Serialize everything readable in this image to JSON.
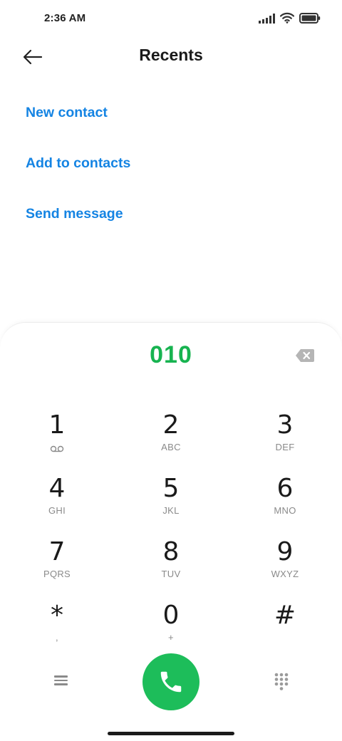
{
  "status_bar": {
    "time": "2:36 AM",
    "icons": [
      "signal-icon",
      "wifi-icon",
      "battery-icon"
    ]
  },
  "header": {
    "title": "Recents",
    "back_icon": "back-arrow-icon"
  },
  "actions": [
    {
      "label": "New contact"
    },
    {
      "label": "Add to contacts"
    },
    {
      "label": "Send message"
    }
  ],
  "dialer": {
    "number": "010",
    "backspace_icon": "backspace-icon",
    "keys": [
      {
        "digit": "1",
        "letters": "",
        "sub_icon": "voicemail-icon"
      },
      {
        "digit": "2",
        "letters": "ABC"
      },
      {
        "digit": "3",
        "letters": "DEF"
      },
      {
        "digit": "4",
        "letters": "GHI"
      },
      {
        "digit": "5",
        "letters": "JKL"
      },
      {
        "digit": "6",
        "letters": "MNO"
      },
      {
        "digit": "7",
        "letters": "PQRS"
      },
      {
        "digit": "8",
        "letters": "TUV"
      },
      {
        "digit": "9",
        "letters": "WXYZ"
      },
      {
        "digit": "*",
        "letters": ","
      },
      {
        "digit": "0",
        "letters": "+"
      },
      {
        "digit": "#",
        "letters": ""
      }
    ],
    "bottom_icons": [
      "menu-icon",
      "phone-icon",
      "dialpad-icon"
    ]
  },
  "colors": {
    "accent_blue": "#1584e3",
    "dial_green": "#17b350",
    "call_green": "#1dbd5a"
  }
}
